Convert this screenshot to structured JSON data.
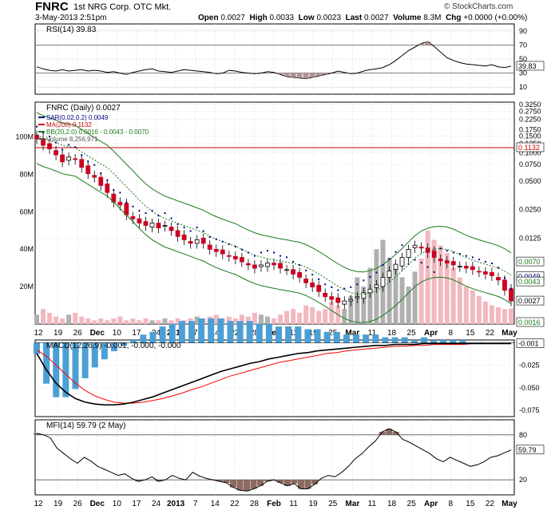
{
  "header": {
    "symbol": "FNRC",
    "company": "1st NRG Corp.  OTC Mkt.",
    "date": "3-May-2013 2:51pm",
    "brand": "© StockCharts.com",
    "quote": {
      "open_label": "Open",
      "open": "0.0027",
      "high_label": "High",
      "high": "0.0033",
      "low_label": "Low",
      "low": "0.0023",
      "last_label": "Last",
      "last": "0.0027",
      "volume_label": "Volume",
      "volume": "8.3M",
      "chg_label": "Chg",
      "chg": "+0.0000 (+0.00%)"
    }
  },
  "colors": {
    "up": "#000000",
    "down": "#cc0022",
    "ma200": "#cc0000",
    "bb": "#1a7a1a",
    "sar": "#000080",
    "macd_hist": "#4b9fd5",
    "macd_signal": "#ff0000",
    "rsi_fill": "#a07878",
    "mfi_fill": "#8b6a60",
    "grid": "#cccccc",
    "volume": "#b0b0b0"
  },
  "chart_data": [
    {
      "type": "line",
      "panel": "RSI",
      "title": "RSI(14) 39.83",
      "y_ticks": [
        "90",
        "70",
        "50",
        "30",
        "10"
      ],
      "ylim": [
        0,
        100
      ],
      "levels": [
        70,
        30
      ],
      "last_value_label": "39.83",
      "series": [
        {
          "name": "RSI(14)",
          "values": [
            39,
            36,
            34,
            33,
            35,
            33,
            34,
            35,
            33,
            34,
            33,
            31,
            32,
            30,
            28,
            31,
            33,
            35,
            36,
            33,
            32,
            31,
            33,
            35,
            34,
            33,
            32,
            31,
            29,
            30,
            34,
            33,
            31,
            30,
            29,
            30,
            32,
            31,
            28,
            25,
            24,
            23,
            22,
            24,
            26,
            28,
            30,
            33,
            31,
            29,
            30,
            33,
            35,
            36,
            38,
            42,
            48,
            55,
            62,
            67,
            72,
            75,
            68,
            60,
            52,
            48,
            45,
            43,
            42,
            41,
            40,
            42,
            39,
            38,
            39.83
          ]
        }
      ]
    },
    {
      "type": "candlestick",
      "panel": "Price",
      "title": "FNRC (Daily) 0.0027",
      "legend": [
        "SAR(0.02,0.2) 0.0049",
        "MA(200) 0.1132",
        "BB(20,2.0) 0.0016 - 0.0043 - 0.0070",
        "Volume 8,256,971"
      ],
      "y_scale": "log",
      "y_ticks": [
        "0.3250",
        "0.2750",
        "0.2250",
        "0.1750",
        "0.1500",
        "0.1250",
        "0.1000",
        "0.0750",
        "0.0500",
        "0.0250",
        "0.0125"
      ],
      "y_value_labels": [
        "0.1132",
        "0.0070",
        "0.0049",
        "0.0043",
        "0.0027",
        "0.0016"
      ],
      "volume_ticks": [
        "100M",
        "80M",
        "60M",
        "40M",
        "20M"
      ],
      "ylim": [
        0.0016,
        0.33
      ],
      "x_tick_labels": [
        "12",
        "19",
        "26",
        "Dec",
        "10",
        "17",
        "24",
        "2013",
        "7",
        "14",
        "22",
        "28",
        "Feb",
        "11",
        "19",
        "25",
        "Mar",
        "11",
        "18",
        "25",
        "Apr",
        "8",
        "15",
        "22",
        "May"
      ],
      "close": [
        0.14,
        0.12,
        0.11,
        0.095,
        0.08,
        0.09,
        0.085,
        0.07,
        0.06,
        0.055,
        0.045,
        0.038,
        0.03,
        0.028,
        0.022,
        0.02,
        0.018,
        0.017,
        0.018,
        0.016,
        0.017,
        0.015,
        0.013,
        0.012,
        0.011,
        0.012,
        0.011,
        0.0095,
        0.009,
        0.0085,
        0.008,
        0.0075,
        0.007,
        0.0065,
        0.006,
        0.0065,
        0.0068,
        0.0065,
        0.006,
        0.0058,
        0.0052,
        0.0048,
        0.0042,
        0.0038,
        0.0034,
        0.003,
        0.0028,
        0.0026,
        0.0027,
        0.0028,
        0.003,
        0.0033,
        0.0036,
        0.004,
        0.0048,
        0.0056,
        0.0066,
        0.0078,
        0.0095,
        0.0105,
        0.0098,
        0.0088,
        0.0078,
        0.0072,
        0.0068,
        0.0065,
        0.0063,
        0.006,
        0.0058,
        0.0055,
        0.0052,
        0.005,
        0.0045,
        0.0035,
        0.0027
      ],
      "ma200": 0.1132,
      "sar_last": 0.0049,
      "bb_last": [
        0.0016,
        0.0043,
        0.007
      ],
      "volume_millions": [
        5,
        8,
        6,
        4,
        3,
        5,
        6,
        4,
        3,
        2,
        3,
        2,
        3,
        4,
        2,
        3,
        2,
        3,
        2,
        2,
        3,
        2,
        3,
        2,
        3,
        4,
        3,
        4,
        5,
        3,
        4,
        3,
        5,
        4,
        6,
        5,
        4,
        3,
        5,
        7,
        8,
        6,
        10,
        9,
        7,
        8,
        12,
        10,
        8,
        15,
        25,
        20,
        30,
        40,
        45,
        35,
        30,
        25,
        20,
        28,
        35,
        50,
        45,
        42,
        38,
        30,
        25,
        20,
        18,
        15,
        12,
        10,
        9,
        8,
        8.3
      ]
    },
    {
      "type": "line",
      "panel": "MACD",
      "title": "MACD(12,26,9) -0.001, -0.000, -0.000",
      "y_ticks": [
        "-0.025",
        "-0.050",
        "-0.075"
      ],
      "ylim": [
        -0.082,
        0.003
      ],
      "last_value_label": "-0.001",
      "series": [
        {
          "name": "MACD(12,26,9)",
          "values": [
            -0.012,
            -0.03,
            -0.045,
            -0.055,
            -0.062,
            -0.066,
            -0.068,
            -0.069,
            -0.069,
            -0.068,
            -0.066,
            -0.063,
            -0.06,
            -0.056,
            -0.052,
            -0.048,
            -0.044,
            -0.04,
            -0.036,
            -0.032,
            -0.029,
            -0.026,
            -0.023,
            -0.021,
            -0.018,
            -0.016,
            -0.014,
            -0.012,
            -0.011,
            -0.009,
            -0.008,
            -0.007,
            -0.006,
            -0.005,
            -0.004,
            -0.003,
            -0.003,
            -0.002,
            -0.002,
            -0.002,
            -0.001,
            -0.001,
            -0.001,
            -0.001,
            -0.001,
            -0.001,
            -0.001,
            -0.001,
            -0.001,
            -0.001
          ]
        },
        {
          "name": "Signal",
          "values": [
            -0.008,
            -0.015,
            -0.025,
            -0.035,
            -0.045,
            -0.053,
            -0.059,
            -0.063,
            -0.066,
            -0.067,
            -0.067,
            -0.066,
            -0.064,
            -0.062,
            -0.059,
            -0.056,
            -0.052,
            -0.049,
            -0.045,
            -0.041,
            -0.037,
            -0.034,
            -0.031,
            -0.028,
            -0.025,
            -0.022,
            -0.02,
            -0.018,
            -0.016,
            -0.014,
            -0.012,
            -0.011,
            -0.009,
            -0.008,
            -0.007,
            -0.006,
            -0.005,
            -0.004,
            -0.004,
            -0.003,
            -0.003,
            -0.002,
            -0.002,
            -0.002,
            -0.002,
            -0.001,
            -0.001,
            -0.001,
            -0.001,
            -0.001
          ]
        }
      ]
    },
    {
      "type": "line",
      "panel": "MFI",
      "title": "MFI(14) 59.79 (2 May)",
      "y_ticks": [
        "80",
        "20"
      ],
      "ylim": [
        0,
        100
      ],
      "levels": [
        80,
        20
      ],
      "last_value_label": "59.79",
      "series": [
        {
          "name": "MFI(14)",
          "values": [
            82,
            80,
            76,
            62,
            55,
            48,
            42,
            50,
            45,
            38,
            34,
            30,
            26,
            28,
            22,
            18,
            20,
            24,
            18,
            20,
            26,
            22,
            20,
            30,
            25,
            22,
            20,
            18,
            16,
            10,
            6,
            5,
            8,
            12,
            18,
            20,
            16,
            12,
            15,
            8,
            8,
            14,
            22,
            26,
            24,
            30,
            38,
            48,
            55,
            64,
            72,
            84,
            88,
            84,
            74,
            70,
            65,
            60,
            55,
            48,
            44,
            50,
            46,
            42,
            38,
            40,
            44,
            50,
            52,
            56,
            59.79
          ]
        }
      ]
    }
  ]
}
